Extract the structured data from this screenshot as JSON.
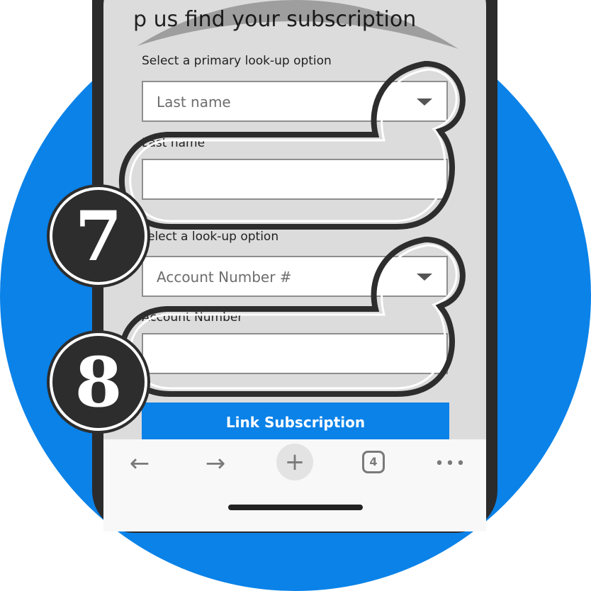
{
  "heading": "p us find your subscription",
  "primary_lookup": {
    "label": "Select a primary look-up option",
    "selected": "Last name"
  },
  "last_name": {
    "label": "Last name",
    "value": ""
  },
  "secondary_lookup": {
    "label": "elect a look-up option",
    "selected": "Account Number #"
  },
  "account_number": {
    "label": "Account Number",
    "value": ""
  },
  "submit_label": "Link Subscription",
  "steps": {
    "seven": "7",
    "eight": "8"
  },
  "browser_toolbar": {
    "back": "←",
    "forward": "→",
    "new_tab": "+",
    "tabs_count": "4",
    "more": "•••"
  },
  "colors": {
    "brand_blue": "#0a82e8",
    "callout_dark": "#2d2d2d"
  }
}
